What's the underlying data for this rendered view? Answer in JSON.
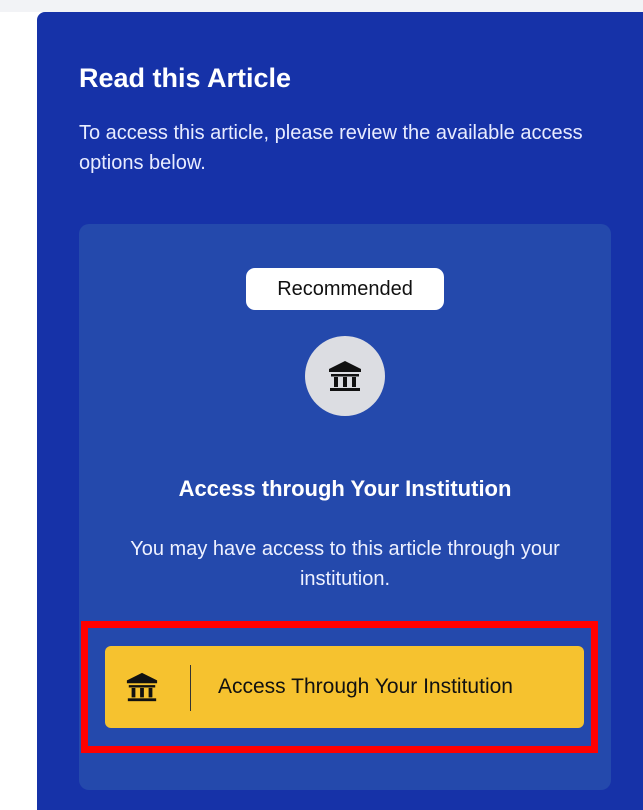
{
  "panel": {
    "title": "Read this Article",
    "description": "To access this article, please review the available access options below."
  },
  "option": {
    "badge": "Recommended",
    "icon": "institution-icon",
    "title": "Access through Your Institution",
    "description": "You may have access to this article through your institution.",
    "button": {
      "icon": "institution-icon",
      "label": "Access Through Your Institution"
    }
  },
  "colors": {
    "panel_background": "#1632a8",
    "card_background": "#2449ac",
    "button_background": "#f6c22f",
    "highlight": "#ff0000",
    "badge_background": "#ffffff"
  }
}
